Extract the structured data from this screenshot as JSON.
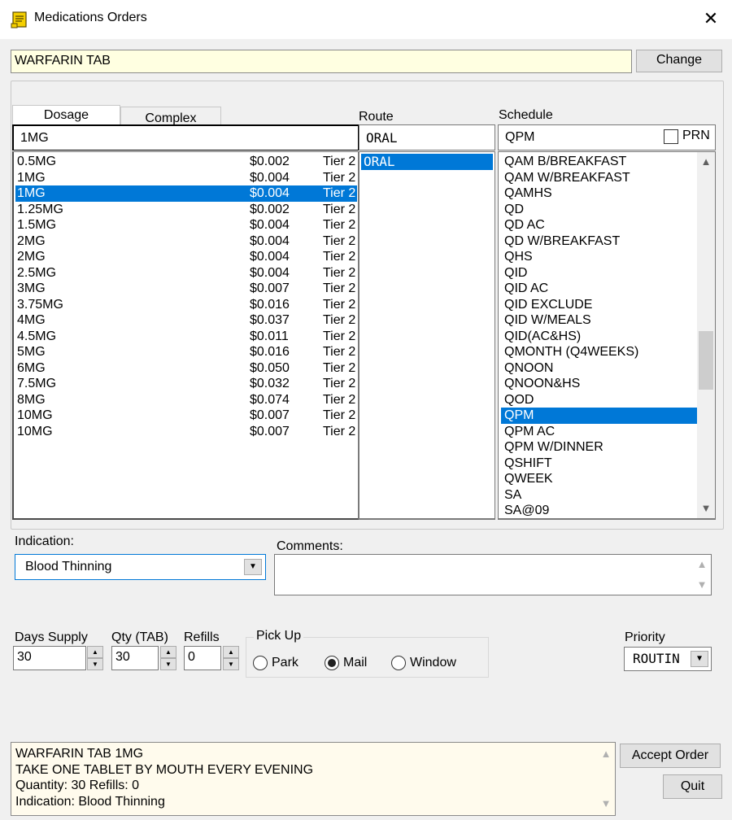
{
  "window": {
    "title": "Medications Orders"
  },
  "drug": {
    "name": "WARFARIN TAB",
    "change_label": "Change"
  },
  "tabs": [
    {
      "label": "Dosage"
    },
    {
      "label": "Complex"
    }
  ],
  "route": {
    "label": "Route",
    "value": "ORAL",
    "options": [
      "ORAL"
    ]
  },
  "schedule": {
    "label": "Schedule",
    "value": "QPM",
    "prn_label": "PRN",
    "options": [
      "QAM B/BREAKFAST",
      "QAM W/BREAKFAST",
      "QAMHS",
      "QD",
      "QD AC",
      "QD W/BREAKFAST",
      "QHS",
      "QID",
      "QID AC",
      "QID EXCLUDE",
      "QID W/MEALS",
      "QID(AC&HS)",
      "QMONTH (Q4WEEKS)",
      "QNOON",
      "QNOON&HS",
      "QOD",
      "QPM",
      "QPM AC",
      "QPM W/DINNER",
      "QSHIFT",
      "QWEEK",
      "SA",
      "SA@09"
    ],
    "selected_index": 16
  },
  "dosage": {
    "value": "1MG",
    "rows": [
      {
        "dose": "0.5MG",
        "price": "$0.002",
        "tier": "Tier 2"
      },
      {
        "dose": "1MG",
        "price": "$0.004",
        "tier": "Tier 2"
      },
      {
        "dose": "1MG",
        "price": "$0.004",
        "tier": "Tier 2"
      },
      {
        "dose": "1.25MG",
        "price": "$0.002",
        "tier": "Tier 2"
      },
      {
        "dose": "1.5MG",
        "price": "$0.004",
        "tier": "Tier 2"
      },
      {
        "dose": "2MG",
        "price": "$0.004",
        "tier": "Tier 2"
      },
      {
        "dose": "2MG",
        "price": "$0.004",
        "tier": "Tier 2"
      },
      {
        "dose": "2.5MG",
        "price": "$0.004",
        "tier": "Tier 2"
      },
      {
        "dose": "3MG",
        "price": "$0.007",
        "tier": "Tier 2"
      },
      {
        "dose": "3.75MG",
        "price": "$0.016",
        "tier": "Tier 2"
      },
      {
        "dose": "4MG",
        "price": "$0.037",
        "tier": "Tier 2"
      },
      {
        "dose": "4.5MG",
        "price": "$0.011",
        "tier": "Tier 2"
      },
      {
        "dose": "5MG",
        "price": "$0.016",
        "tier": "Tier 2"
      },
      {
        "dose": "6MG",
        "price": "$0.050",
        "tier": "Tier 2"
      },
      {
        "dose": "7.5MG",
        "price": "$0.032",
        "tier": "Tier 2"
      },
      {
        "dose": "8MG",
        "price": "$0.074",
        "tier": "Tier 2"
      },
      {
        "dose": "10MG",
        "price": "$0.007",
        "tier": "Tier 2"
      },
      {
        "dose": "10MG",
        "price": "$0.007",
        "tier": "Tier 2"
      }
    ],
    "selected_index": 2
  },
  "indication": {
    "label": "Indication:",
    "value": "Blood Thinning"
  },
  "comments": {
    "label": "Comments:",
    "value": ""
  },
  "supply": {
    "days_label": "Days Supply",
    "days_value": "30",
    "qty_label": "Qty (TAB)",
    "qty_value": "30",
    "refills_label": "Refills",
    "refills_value": "0"
  },
  "pickup": {
    "label": "Pick Up",
    "options": [
      "Park",
      "Mail",
      "Window"
    ],
    "selected": "Mail"
  },
  "priority": {
    "label": "Priority",
    "value": "ROUTIN"
  },
  "summary": {
    "lines": [
      "WARFARIN TAB  1MG",
      "TAKE ONE TABLET BY MOUTH EVERY EVENING",
      "Quantity: 30 Refills: 0",
      "Indication: Blood Thinning"
    ]
  },
  "buttons": {
    "accept": "Accept Order",
    "quit": "Quit"
  },
  "colors": {
    "selection": "#0078d7",
    "drug_field_bg": "#ffffe1",
    "summary_bg": "#fffbed"
  }
}
